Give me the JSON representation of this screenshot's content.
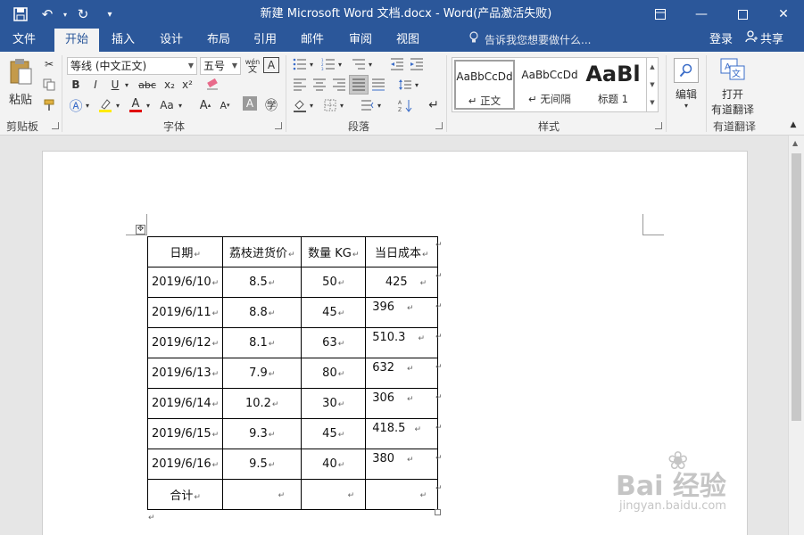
{
  "titlebar": {
    "title": "新建 Microsoft Word 文档.docx  -  Word(产品激活失败)",
    "qat": [
      "save-icon",
      "undo-icon",
      "redo-icon",
      "customize-icon"
    ],
    "controls": [
      "ribbon-display-icon",
      "minimize-icon",
      "maximize-icon",
      "close-icon"
    ]
  },
  "tabs": [
    "文件",
    "开始",
    "插入",
    "设计",
    "布局",
    "引用",
    "邮件",
    "审阅",
    "视图"
  ],
  "active_tab": "开始",
  "tellme": "告诉我您想要做什么...",
  "login": "登录",
  "share": "共享",
  "ribbon": {
    "clipboard": {
      "paste": "粘贴",
      "label": "剪贴板"
    },
    "font": {
      "font_name": "等线 (中文正文)",
      "font_size": "五号",
      "wen": "wén",
      "label": "字体",
      "buttons": [
        "B",
        "I",
        "U",
        "abc",
        "x₂",
        "x²"
      ],
      "aa": "Aa"
    },
    "paragraph": {
      "label": "段落"
    },
    "styles": {
      "label": "样式",
      "items": [
        {
          "sample": "AaBbCcDd",
          "name": "↵ 正文"
        },
        {
          "sample": "AaBbCcDd",
          "name": "↵ 无间隔"
        },
        {
          "sample": "AaBl",
          "name": "标题 1"
        }
      ]
    },
    "editing": {
      "label": "编辑"
    },
    "translate": {
      "line1": "打开",
      "line2": "有道翻译",
      "label": "有道翻译"
    }
  },
  "table": {
    "headers": [
      "日期",
      "荔枝进货价",
      "数量 KG",
      "当日成本"
    ],
    "rows": [
      [
        "2019/6/10",
        "8.5",
        "50",
        "425"
      ],
      [
        "2019/6/11",
        "8.8",
        "45",
        "396"
      ],
      [
        "2019/6/12",
        "8.1",
        "63",
        "510.3"
      ],
      [
        "2019/6/13",
        "7.9",
        "80",
        "632"
      ],
      [
        "2019/6/14",
        "10.2",
        "30",
        "306"
      ],
      [
        "2019/6/15",
        "9.3",
        "45",
        "418.5"
      ],
      [
        "2019/6/16",
        "9.5",
        "40",
        "380"
      ]
    ],
    "total_row": [
      "合计",
      "",
      "",
      ""
    ]
  },
  "watermark": {
    "main": "Bai  经验",
    "sub": "jingyan.baidu.com"
  },
  "colors": {
    "brand": "#2b579a",
    "ribbon": "#f3f3f3",
    "canvas": "#e6e6e6"
  }
}
